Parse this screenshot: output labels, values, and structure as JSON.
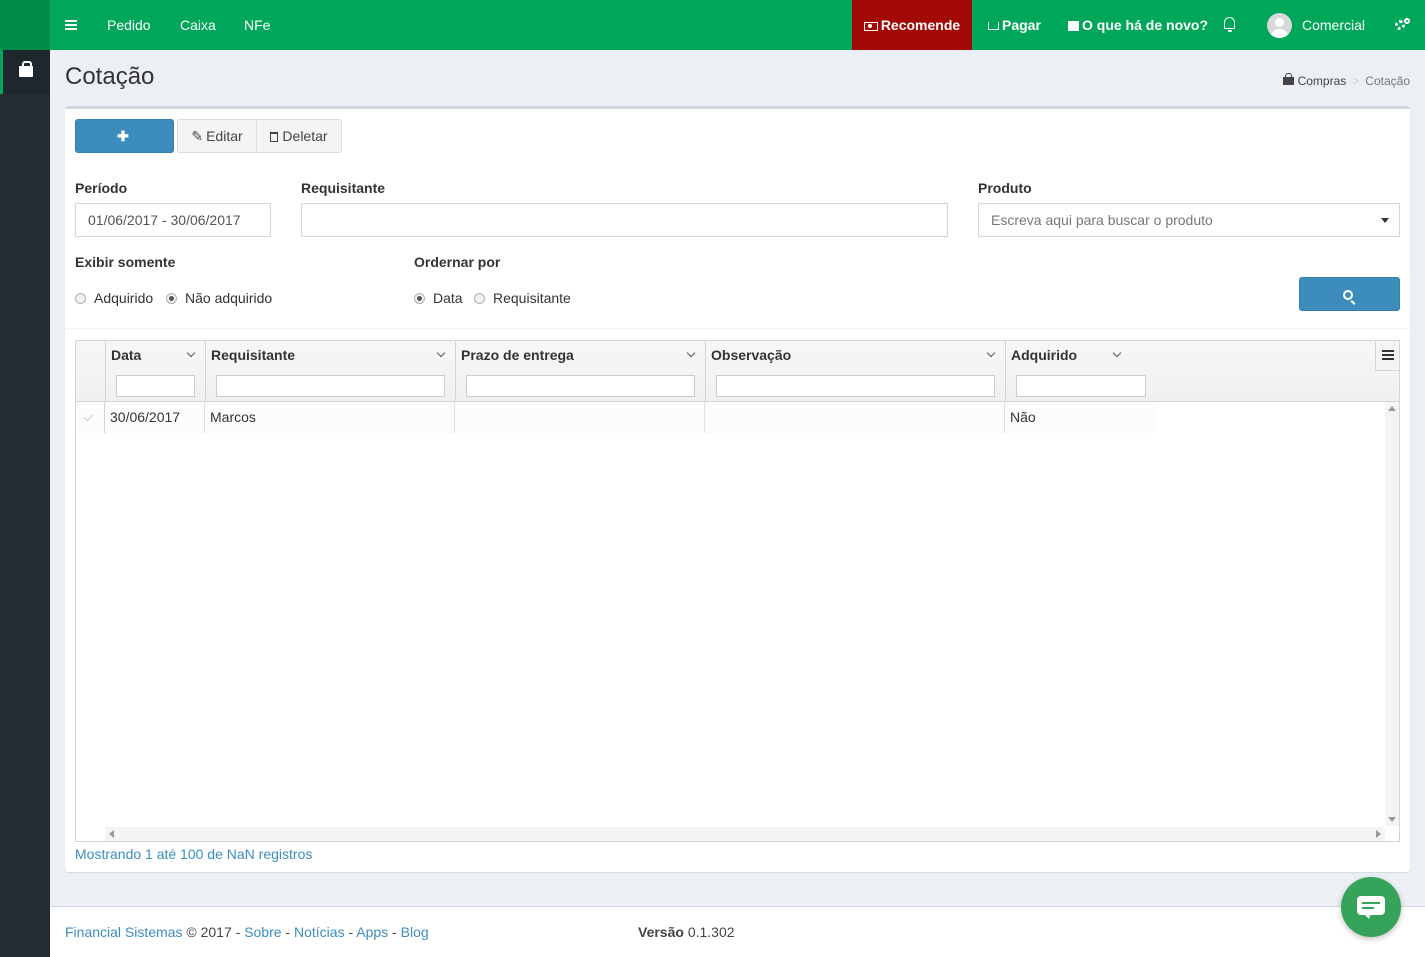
{
  "navbar": {
    "items": [
      "Pedido",
      "Caixa",
      "NFe"
    ],
    "recomende": "Recomende",
    "pagar": "Pagar",
    "novidades": "O que há de novo?",
    "user": "Comercial"
  },
  "header": {
    "title": "Cotação",
    "breadcrumb": [
      "Compras",
      "Cotação"
    ]
  },
  "toolbar": {
    "add": "Adicionar",
    "edit": "Editar",
    "delete": "Deletar"
  },
  "filters": {
    "periodo_label": "Período",
    "periodo_value": "01/06/2017 - 30/06/2017",
    "requisitante_label": "Requisitante",
    "requisitante_value": "",
    "produto_label": "Produto",
    "produto_placeholder": "Escreva aqui para buscar o produto",
    "exibir_label": "Exibir somente",
    "exibir_options": [
      "Adquirido",
      "Não adquirido"
    ],
    "exibir_selected": "Não adquirido",
    "ordenar_label": "Ordernar por",
    "ordenar_options": [
      "Data",
      "Requisitante"
    ],
    "ordenar_selected": "Data",
    "search": "Pesquisar"
  },
  "grid": {
    "columns": [
      "Data",
      "Requisitante",
      "Prazo de entrega",
      "Observação",
      "Adquirido"
    ],
    "rows": [
      [
        "30/06/2017",
        "Marcos",
        "",
        "",
        "Não"
      ]
    ],
    "info": "Mostrando 1 até 100 de NaN registros"
  },
  "footer": {
    "company": "Financial Sistemas",
    "copyright": "© 2017 -",
    "links": [
      "Sobre",
      "Notícias",
      "Apps",
      "Blog"
    ],
    "version_label": "Versão",
    "version": "0.1.302"
  },
  "colors": {
    "brand_green": "#00a65a",
    "dark_green": "#008d4c",
    "recomende_red": "#a30a06",
    "primary_blue": "#3c8dbc",
    "sidebar_dark": "#222d32"
  },
  "icons": [
    "hamburger-icon",
    "money-icon",
    "cart-icon",
    "gift-icon",
    "bell-icon",
    "cogs-icon",
    "shopping-bag-icon",
    "plus-icon",
    "edit-icon",
    "trash-icon",
    "search-icon",
    "chat-icon",
    "check-icon"
  ]
}
